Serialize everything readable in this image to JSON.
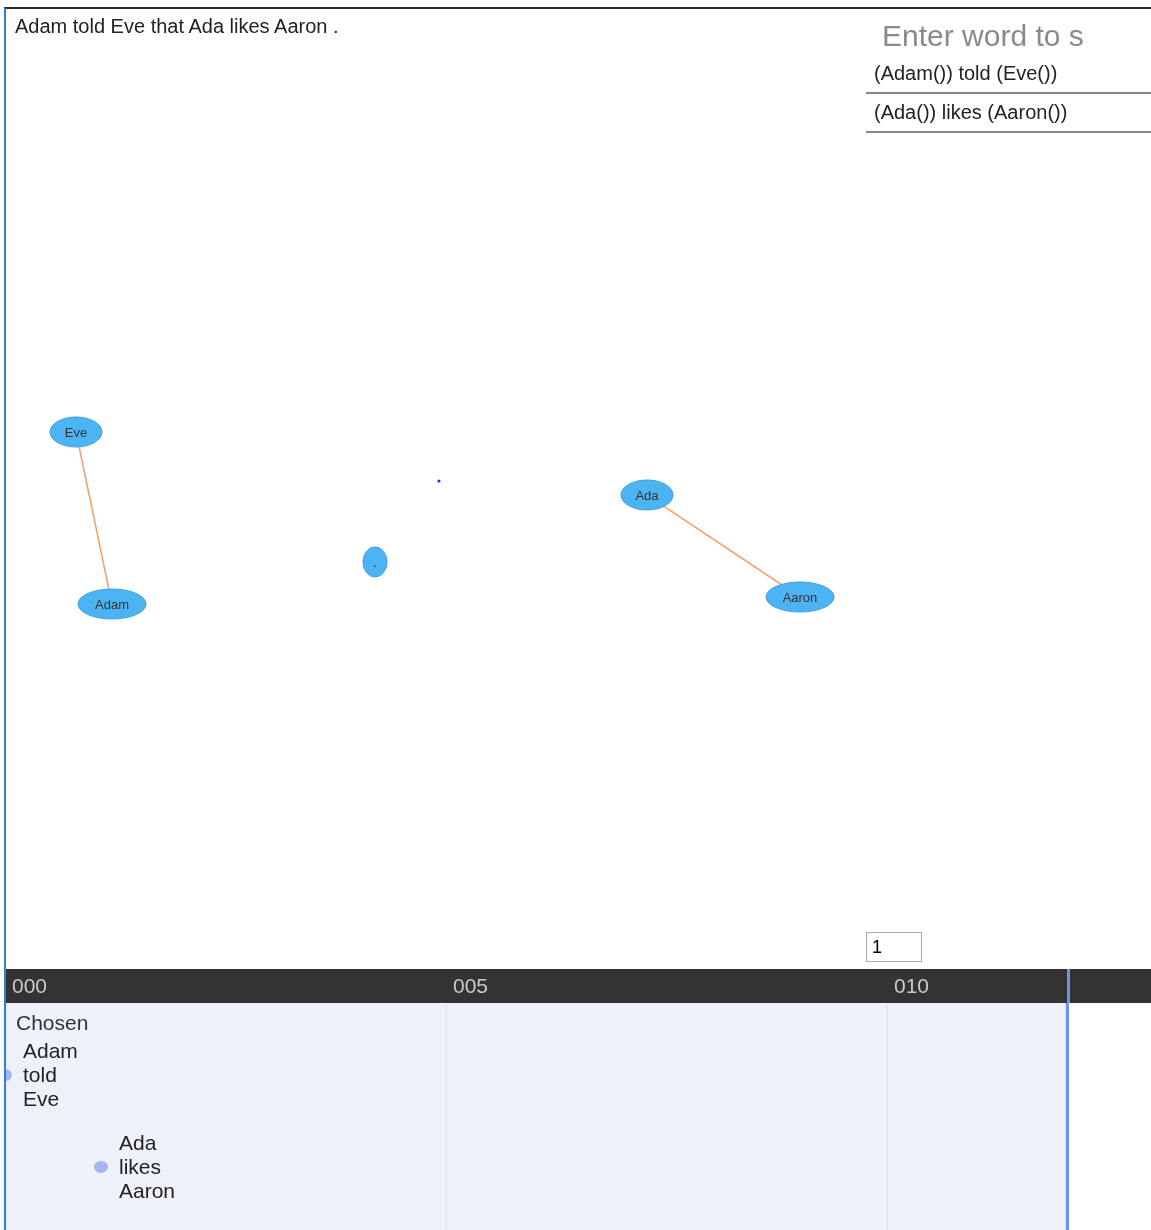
{
  "sentence": "Adam told Eve that Ada likes Aaron .",
  "graph": {
    "components": [
      {
        "connected": true,
        "nodes": [
          {
            "label": "Eve"
          },
          {
            "label": "Adam"
          }
        ]
      },
      {
        "connected": false,
        "nodes": [
          {
            "label": "."
          }
        ]
      },
      {
        "connected": true,
        "nodes": [
          {
            "label": "Ada"
          },
          {
            "label": "Aaron"
          }
        ]
      }
    ]
  },
  "search": {
    "placeholder": "Enter word to s"
  },
  "results": [
    "(Adam()) told (Eve())",
    "(Ada()) likes (Aaron())"
  ],
  "number_field": {
    "value": "1"
  },
  "timeline": {
    "ticks": [
      "000",
      "005",
      "010"
    ],
    "group": "Chosen",
    "items": [
      {
        "text": "Adam told Eve"
      },
      {
        "text": "Ada likes Aaron"
      }
    ]
  }
}
